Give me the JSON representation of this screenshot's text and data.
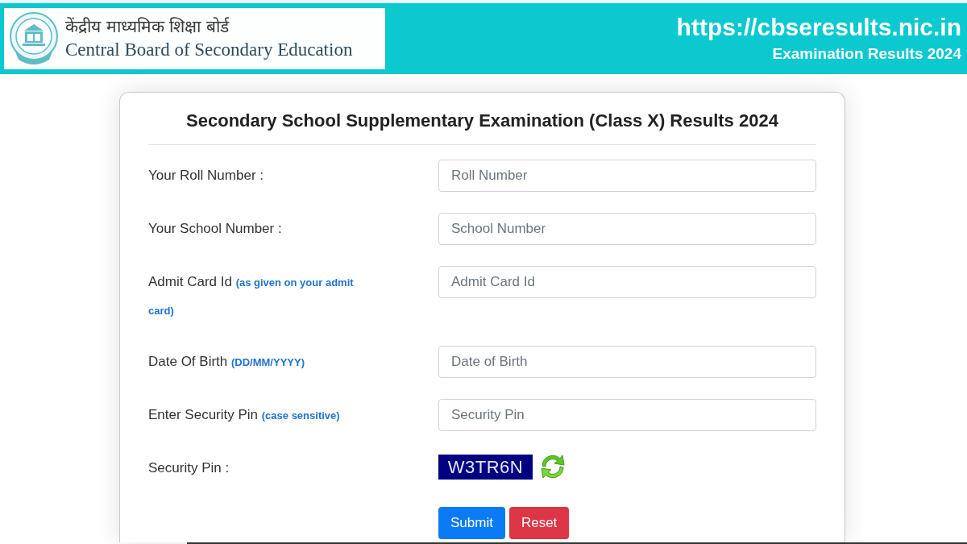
{
  "header": {
    "logo": {
      "hindi_name": "केंद्रीय माध्यमिक शिक्षा बोर्ड",
      "english_name": "Central Board of Secondary Education"
    },
    "site_url": "https://cbseresults.nic.in",
    "subtitle": "Examination Results 2024"
  },
  "form": {
    "title": "Secondary School Supplementary Examination (Class X) Results 2024",
    "fields": [
      {
        "kind": "input",
        "label": "Your Roll Number :",
        "placeholder": "Roll Number"
      },
      {
        "kind": "input",
        "label": "Your School Number :",
        "placeholder": "School Number"
      },
      {
        "kind": "input",
        "label": "Admit Card Id **(as given on your admit card)**",
        "placeholder": "Admit Card Id"
      },
      {
        "kind": "input",
        "label": "Date Of Birth **(DD/MM/YYYY)**",
        "placeholder": "Date of Birth"
      },
      {
        "kind": "input",
        "label": "Enter Security Pin **(case sensitive)**",
        "placeholder": "Security Pin"
      },
      {
        "kind": "captcha",
        "label": "Security Pin :",
        "code": "W3TR6N"
      }
    ],
    "buttons": [
      {
        "kind": "primary",
        "label": "Submit"
      },
      {
        "kind": "danger",
        "label": "Reset"
      }
    ]
  }
}
